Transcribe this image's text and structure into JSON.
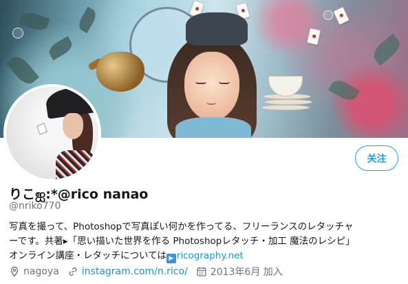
{
  "profile": {
    "display_name": "りこஐ:*@rico nanao",
    "handle": "@nriko770",
    "follow_label": "关注",
    "bio": {
      "line1": "写真を撮って、Photoshopで写真ぽい何かを作ってる、フリーランスのレタッチャ",
      "line2": "ーです。共著▸「思い描いた世界を作る Photoshopレタッチ・加工 魔法のレシピ」",
      "line3_text": "オンライン講座・レタッチについては",
      "line3_badge": "▶",
      "line3_link": "ricography.net"
    },
    "meta": {
      "location": "nagoya",
      "website": "instagram.com/n.rico/",
      "joined": "2013年6月 加入"
    }
  },
  "icons": {
    "location": "location-pin-icon",
    "link": "link-icon",
    "calendar": "calendar-icon"
  },
  "colors": {
    "accent": "#1da1f2",
    "link": "#1b95e0",
    "secondary_text": "#657786",
    "primary_text": "#14171a"
  }
}
